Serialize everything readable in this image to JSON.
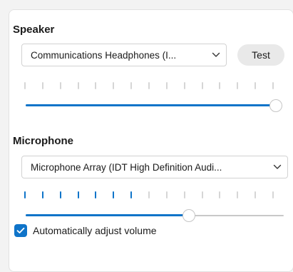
{
  "colors": {
    "accent": "#0f74c9",
    "meter_inactive": "#d6d6d6"
  },
  "speaker": {
    "heading": "Speaker",
    "device": "Communications Headphones (I...",
    "test_label": "Test",
    "level_ticks_active": 0,
    "level_ticks_total": 15,
    "volume": 1.0,
    "dropdown_icon": "chevron-down-icon"
  },
  "microphone": {
    "heading": "Microphone",
    "device": "Microphone Array (IDT High Definition Audi...",
    "level_ticks_active": 7,
    "level_ticks_total": 15,
    "volume": 0.65,
    "dropdown_icon": "chevron-down-icon"
  },
  "auto_adjust": {
    "label": "Automatically adjust volume",
    "checked": true,
    "icon": "checkmark-icon"
  }
}
